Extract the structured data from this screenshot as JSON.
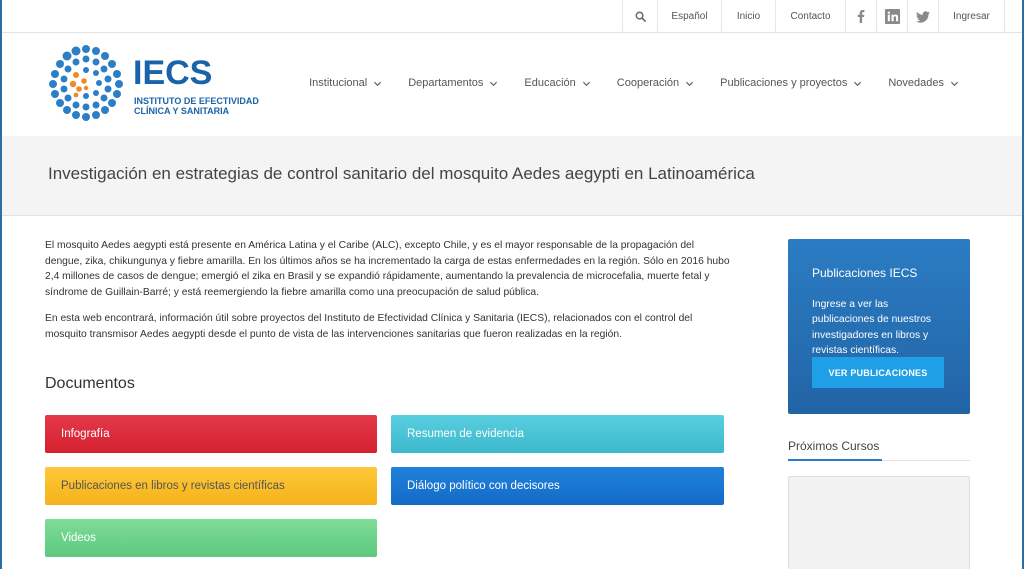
{
  "topbar": {
    "language": "Español",
    "inicio": "Inicio",
    "contacto": "Contacto",
    "ingresar": "Ingresar",
    "social": [
      "facebook-icon",
      "linkedin-icon",
      "twitter-icon"
    ]
  },
  "logo": {
    "name": "IECS",
    "line1": "INSTITUTO DE EFECTIVIDAD",
    "line2": "CLÍNICA Y SANITARIA"
  },
  "nav": [
    {
      "label": "Institucional"
    },
    {
      "label": "Departamentos"
    },
    {
      "label": "Educación"
    },
    {
      "label": "Cooperación"
    },
    {
      "label": "Publicaciones y proyectos"
    },
    {
      "label": "Novedades"
    }
  ],
  "page": {
    "title": "Investigación en estrategias de control sanitario del mosquito Aedes aegypti en Latinoamérica",
    "para1": "El mosquito Aedes aegypti está presente en América Latina y el Caribe (ALC), excepto Chile, y es el mayor responsable de la propagación del dengue, zika, chikungunya y fiebre amarilla. En los últimos años se ha incrementado la carga de estas enfermedades en la región. Sólo en 2016 hubo 2,4 millones de casos de dengue; emergió el zika en Brasil y se expandió rápidamente, aumentando la prevalencia de microcefalia, muerte fetal y síndrome de Guillain-Barré; y está reemergiendo la fiebre amarilla como una preocupación de salud pública.",
    "para2": "En esta web encontrará, información útil sobre proyectos del Instituto de Efectividad Clínica y Sanitaria (IECS), relacionados con el control del mosquito transmisor Aedes aegypti desde el punto de vista de las intervenciones sanitarias que fueron realizadas en la región."
  },
  "documents": {
    "title": "Documentos",
    "infografia": "Infografía",
    "resumen": "Resumen de evidencia",
    "publicaciones": "Publicaciones en libros y revistas científicas",
    "dialogo": "Diálogo político con decisores",
    "videos": "Videos"
  },
  "sidebar": {
    "pub_title": "Publicaciones IECS",
    "pub_text": "Ingrese a ver las publicaciones de nuestros investigadores en libros y revistas científicas.",
    "pub_button": "VER PUBLICACIONES",
    "cursos_title": "Próximos Cursos"
  },
  "colors": {
    "brand": "#1a63a8",
    "infografia": "#d5202f",
    "resumen": "#3cb8cc",
    "publicaciones": "#f4b21a",
    "dialogo": "#146bc6",
    "videos": "#5cc97e"
  }
}
